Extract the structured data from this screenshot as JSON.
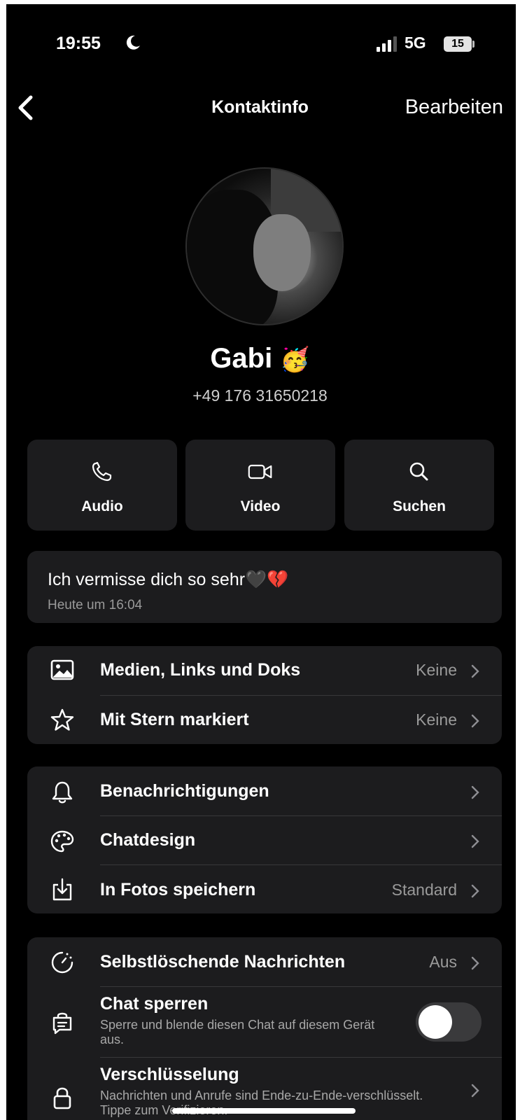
{
  "status_bar": {
    "time": "19:55",
    "network": "5G",
    "battery": "15"
  },
  "nav": {
    "title": "Kontaktinfo",
    "edit": "Bearbeiten"
  },
  "contact": {
    "name": "Gabi",
    "name_emoji": "🥳",
    "phone": "+49 176 31650218"
  },
  "actions": [
    {
      "label": "Audio",
      "icon": "phone-icon"
    },
    {
      "label": "Video",
      "icon": "video-icon"
    },
    {
      "label": "Suchen",
      "icon": "search-icon"
    }
  ],
  "status": {
    "text": "Ich vermisse dich so sehr🖤💔",
    "time": "Heute um 16:04"
  },
  "group1": [
    {
      "label": "Medien, Links und Doks",
      "value": "Keine",
      "icon": "media-icon"
    },
    {
      "label": "Mit Stern markiert",
      "value": "Keine",
      "icon": "star-icon"
    }
  ],
  "group2": [
    {
      "label": "Benachrichtigungen",
      "value": "",
      "icon": "bell-icon"
    },
    {
      "label": "Chatdesign",
      "value": "",
      "icon": "palette-icon"
    },
    {
      "label": "In Fotos speichern",
      "value": "Standard",
      "icon": "save-icon"
    }
  ],
  "group3": {
    "disappearing": {
      "label": "Selbstlöschende Nachrichten",
      "value": "Aus",
      "icon": "timer-icon"
    },
    "lock": {
      "label": "Chat sperren",
      "sub": "Sperre und blende diesen Chat auf diesem Gerät aus.",
      "toggle_on": false,
      "icon": "chat-lock-icon"
    },
    "encryption": {
      "label": "Verschlüsselung",
      "sub": "Nachrichten und Anrufe sind Ende-zu-Ende-verschlüsselt. Tippe zum Verifizieren.",
      "icon": "lock-icon"
    }
  }
}
